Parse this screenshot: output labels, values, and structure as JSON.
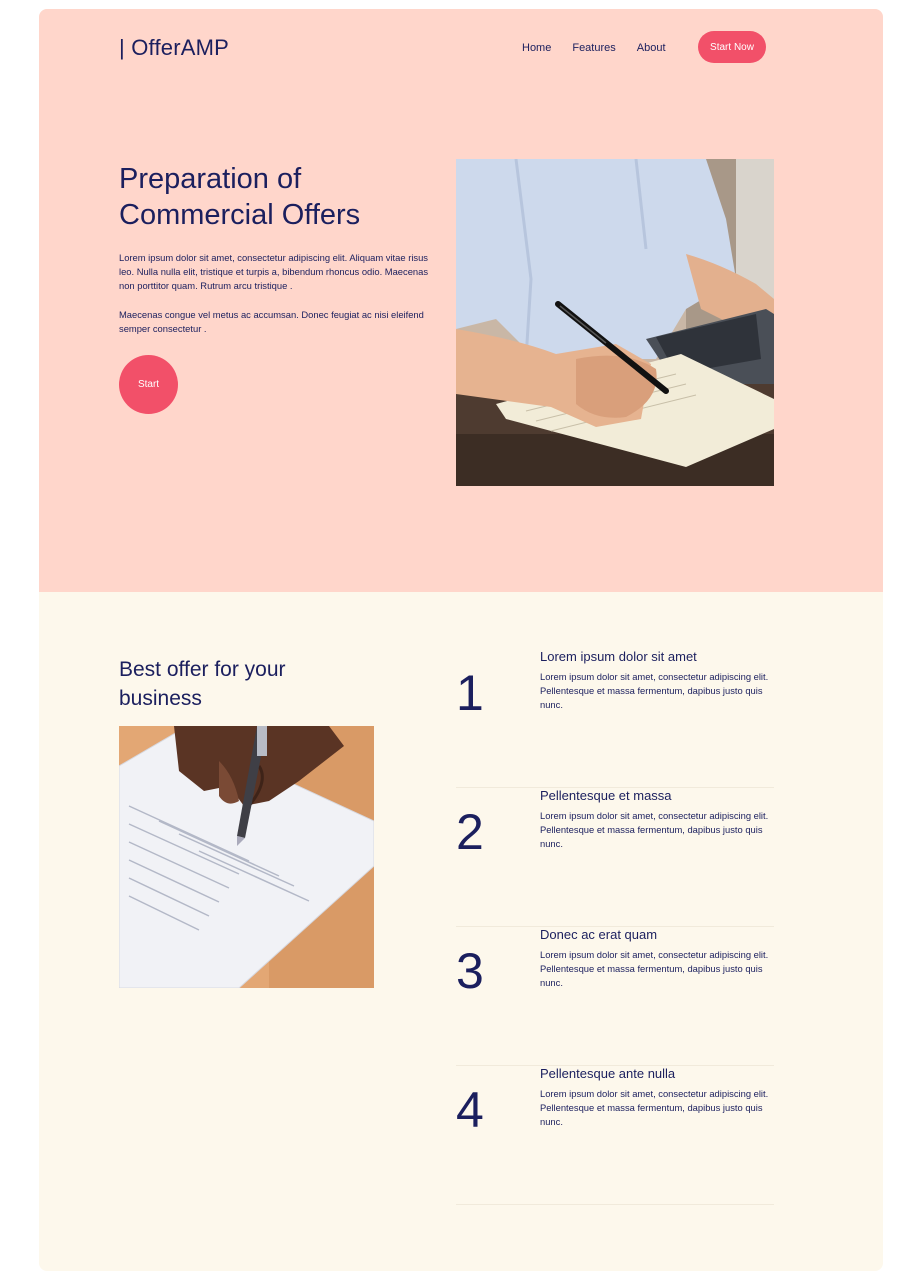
{
  "brand": {
    "name": "| OfferAMP"
  },
  "nav": {
    "items": [
      {
        "label": "Home"
      },
      {
        "label": "Features"
      },
      {
        "label": "About"
      }
    ],
    "cta_label": "Start Now"
  },
  "hero": {
    "title": "Preparation of Commercial Offers",
    "paragraph1": "Lorem ipsum dolor sit amet, consectetur adipiscing elit. Aliquam vitae risus leo. Nulla nulla elit, tristique et turpis a, bibendum rhoncus odio. Maecenas non porttitor quam. Rutrum arcu tristique .",
    "paragraph2": "Maecenas congue vel metus ac accumsan. Donec feugiat ac nisi eleifend semper consectetur .",
    "start_label": "Start"
  },
  "section": {
    "title": "Best offer for your business",
    "features": [
      {
        "number": "1",
        "title": "Lorem ipsum dolor sit amet",
        "description": "Lorem ipsum dolor sit amet, consectetur adipiscing elit. Pellentesque et massa fermentum, dapibus justo quis nunc."
      },
      {
        "number": "2",
        "title": "Pellentesque et massa",
        "description": "Lorem ipsum dolor sit amet, consectetur adipiscing elit. Pellentesque et massa fermentum, dapibus justo quis nunc."
      },
      {
        "number": "3",
        "title": "Donec ac erat quam",
        "description": "Lorem ipsum dolor sit amet, consectetur adipiscing elit. Pellentesque et massa fermentum, dapibus justo quis nunc."
      },
      {
        "number": "4",
        "title": "Pellentesque ante nulla",
        "description": "Lorem ipsum dolor sit amet, consectetur adipiscing elit. Pellentesque et massa fermentum, dapibus justo quis nunc."
      }
    ]
  },
  "colors": {
    "hero_bg": "#ffd6cb",
    "section_bg": "#fdf8ec",
    "accent": "#f25069",
    "text": "#1b1f5e"
  }
}
